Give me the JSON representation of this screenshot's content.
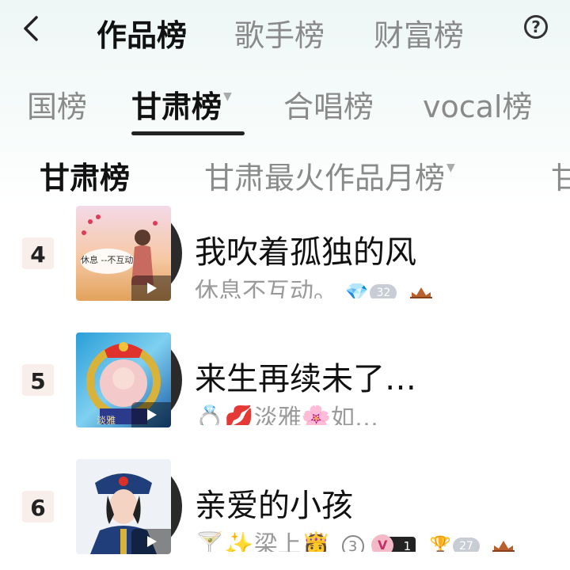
{
  "header": {
    "tabs": [
      {
        "label": "作品榜",
        "active": true
      },
      {
        "label": "歌手榜",
        "active": false
      },
      {
        "label": "财富榜",
        "active": false
      }
    ],
    "help_icon": "question-circle-icon",
    "back_icon": "chevron-left-icon"
  },
  "subtabs": [
    {
      "label": "国榜",
      "active": false
    },
    {
      "label": "甘肃榜",
      "active": true,
      "has_caret": true
    },
    {
      "label": "合唱榜",
      "active": false
    },
    {
      "label": "vocal榜",
      "active": false
    }
  ],
  "filters": [
    {
      "label": "甘肃榜",
      "active": true
    },
    {
      "label": "甘肃最火作品月榜",
      "active": false,
      "has_caret": true
    },
    {
      "label": "甘",
      "active": false
    }
  ],
  "rows": [
    {
      "rank": "4",
      "title": "我吹着孤独的风",
      "author": "休息不互动。",
      "cover_text": "休息 --不互动",
      "gem_count": "32"
    },
    {
      "rank": "5",
      "title": "来生再续未了…",
      "author": "💍💋淡雅🌸如…",
      "cover_text": "淡雅"
    },
    {
      "rank": "6",
      "title": "亲爱的小孩",
      "author": "🍸✨梁上👸",
      "circled": "3",
      "vip_level": "1",
      "trophy_count": "27"
    }
  ],
  "colors": {
    "accent": "#111111",
    "muted": "#8a8a8a",
    "gem": "#3aa9e8",
    "rank_bg": "#f8eeea"
  }
}
